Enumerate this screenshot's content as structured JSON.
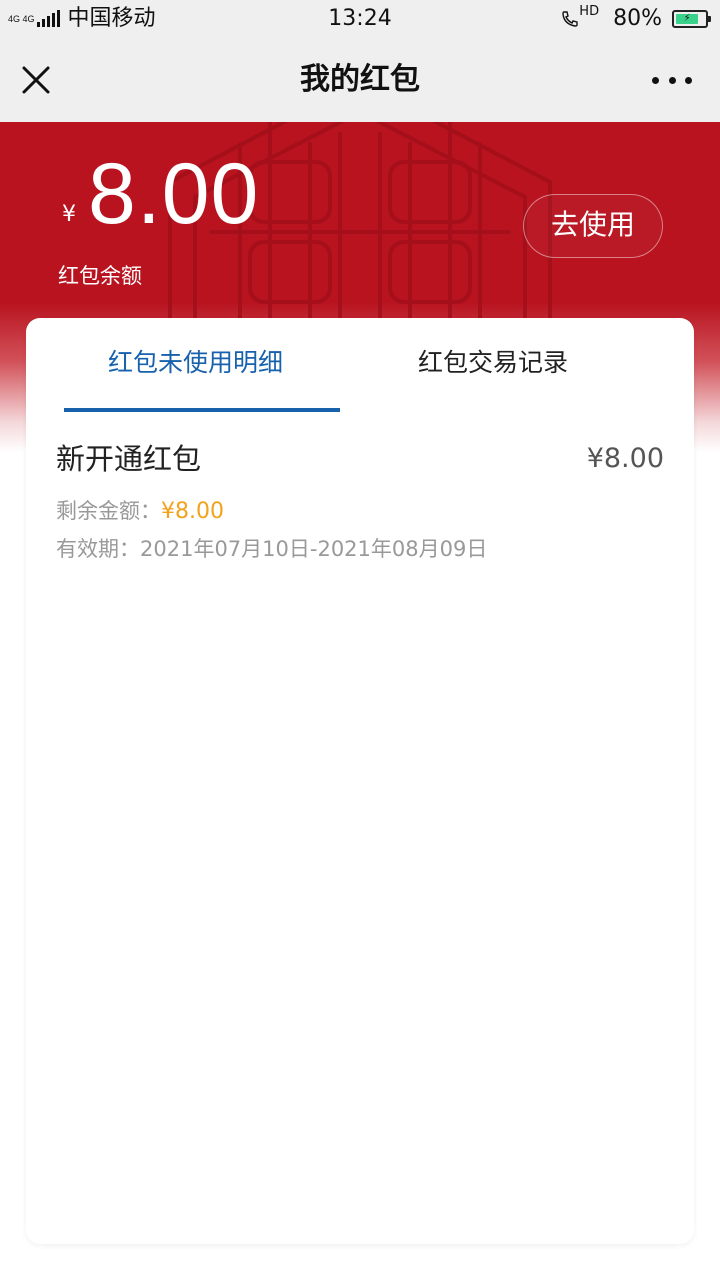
{
  "status_bar": {
    "network_tag": "4G 4G",
    "carrier": "中国移动",
    "time": "13:24",
    "call_tag": "HD",
    "battery_percent": "80%",
    "battery_level": 0.8
  },
  "nav": {
    "title": "我的红包",
    "close_icon": "close-icon",
    "more_icon": "more-icon"
  },
  "hero": {
    "currency_symbol": "¥",
    "amount": "8.00",
    "label": "红包余额",
    "use_button_label": "去使用",
    "background_color": "#b8131f"
  },
  "tabs": [
    {
      "label": "红包未使用明细",
      "active": true
    },
    {
      "label": "红包交易记录",
      "active": false
    }
  ],
  "items": [
    {
      "title": "新开通红包",
      "amount": "¥8.00",
      "remaining_label": "剩余金额：",
      "remaining_value": "¥8.00",
      "validity": "有效期：2021年07月10日-2021年08月09日"
    }
  ],
  "colors": {
    "accent": "#1862ad",
    "highlight": "#f3a21c",
    "brand_red": "#b8131f"
  }
}
